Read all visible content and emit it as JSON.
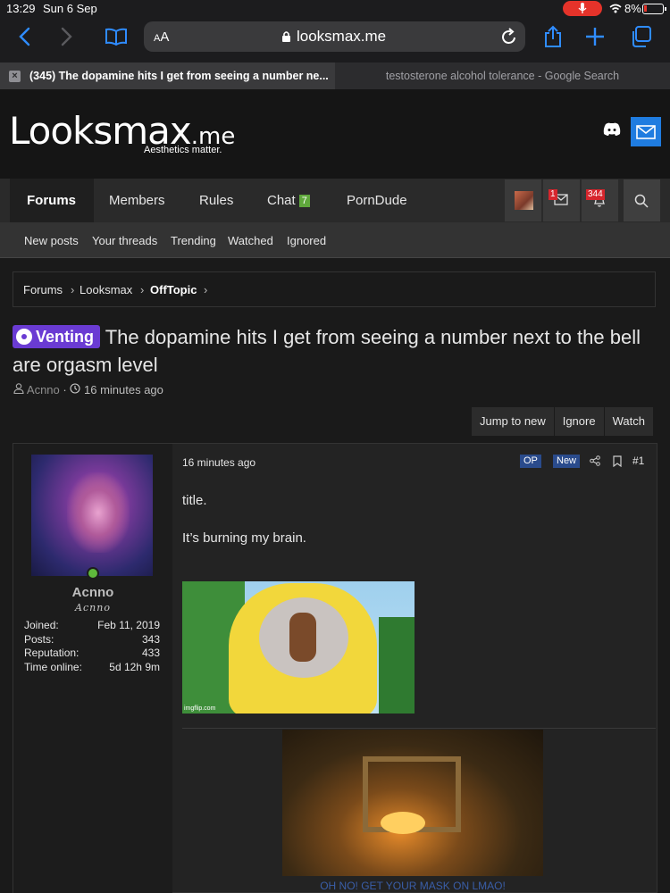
{
  "status": {
    "time": "13:29",
    "date": "Sun 6 Sep",
    "battery": "8%"
  },
  "browser": {
    "aa_label": "AA",
    "url": "looksmax.me",
    "tabs": [
      {
        "title": "(345) The dopamine hits I get from seeing a number ne...",
        "active": true
      },
      {
        "title": "testosterone alcohol tolerance - Google Search",
        "active": false
      }
    ]
  },
  "site": {
    "logo_main": "Looksmax",
    "logo_suffix": ".me",
    "tagline": "Aesthetics matter.",
    "nav": [
      "Forums",
      "Members",
      "Rules",
      "Chat",
      "PornDude"
    ],
    "chat_badge": "7",
    "alerts_count": "344",
    "inbox_count": "1",
    "subnav": [
      "New posts",
      "Your threads",
      "Trending",
      "Watched",
      "Ignored"
    ]
  },
  "breadcrumb": [
    "Forums",
    "Looksmax",
    "OffTopic"
  ],
  "thread": {
    "prefix": "Venting",
    "title": "The dopamine hits I get from seeing a number next to the bell are orgasm level",
    "author": "Acnno",
    "time": "16 minutes ago",
    "actions": [
      "Jump to new",
      "Ignore",
      "Watch"
    ]
  },
  "post": {
    "user": {
      "name": "Acnno",
      "title": "Acnno",
      "stats": [
        {
          "label": "Joined:",
          "value": "Feb 11, 2019"
        },
        {
          "label": "Posts:",
          "value": "343"
        },
        {
          "label": "Reputation:",
          "value": "433"
        },
        {
          "label": "Time online:",
          "value": "5d 12h 9m"
        }
      ]
    },
    "time": "16 minutes ago",
    "tag_op": "OP",
    "tag_new": "New",
    "number": "#1",
    "lines": [
      "title.",
      "It’s burning my brain."
    ],
    "image1_watermark": "imgflip.com",
    "gif_caption": "OH NO! GET YOUR MASK ON LMAO!"
  },
  "colors": {
    "accent": "#1f7ce0",
    "prefix": "#6a3bd3",
    "badge_red": "#d7262d",
    "chat_green": "#5fa83c"
  }
}
